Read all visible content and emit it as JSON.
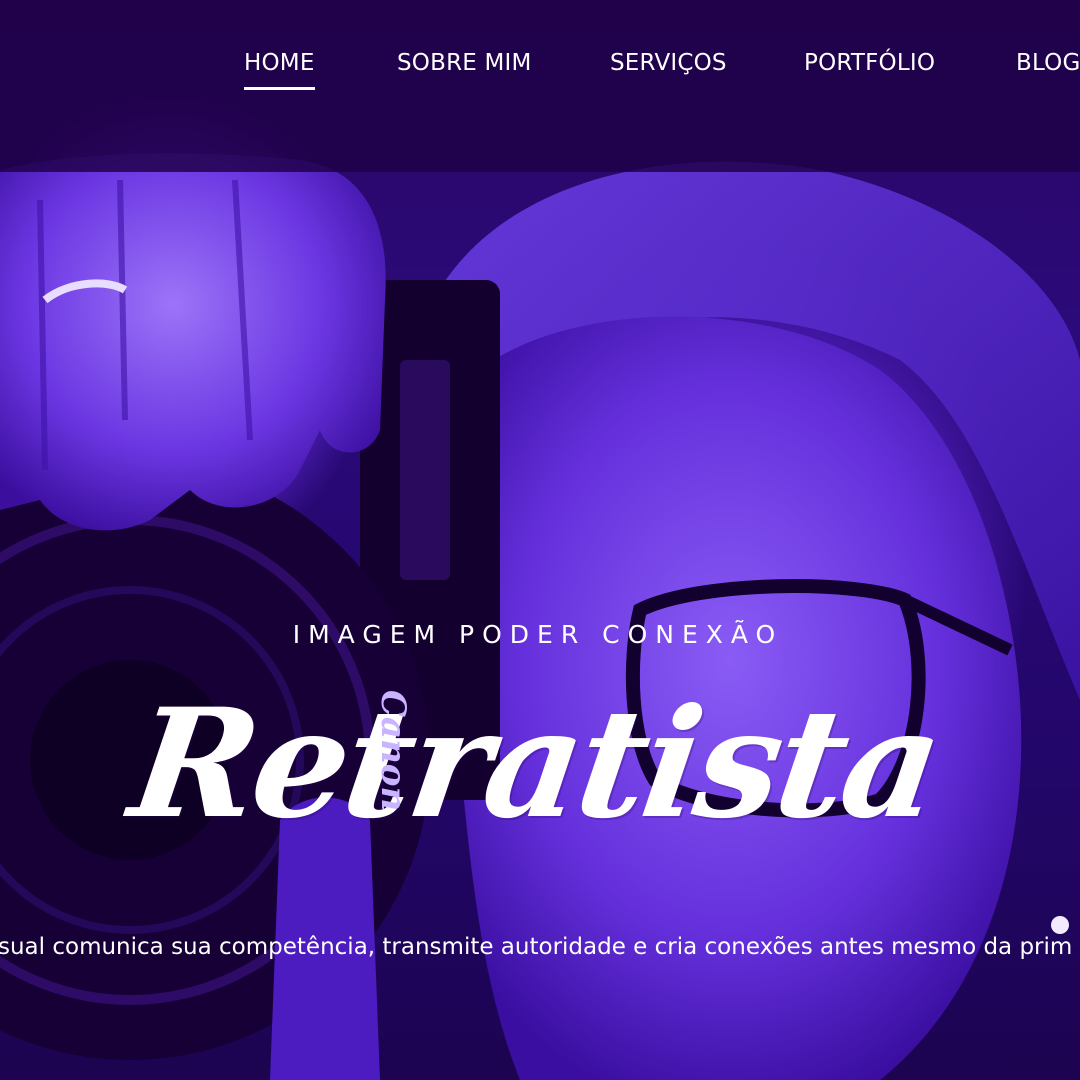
{
  "nav": {
    "items": [
      {
        "label": "HOME",
        "active": true
      },
      {
        "label": "SOBRE MIM",
        "active": false
      },
      {
        "label": "SERVIÇOS",
        "active": false
      },
      {
        "label": "PORTFÓLIO",
        "active": false
      },
      {
        "label": "BLOG",
        "active": false
      }
    ]
  },
  "hero": {
    "tagline": "IMAGEM PODER CONEXÃO",
    "title": "Retratista",
    "subline": "visual comunica sua competência, transmite autoridade e cria conexões antes mesmo da prim",
    "camera_brand": "Canon",
    "photo_description_icon": "photographer-photo"
  },
  "colors": {
    "overlay": "#1e0046",
    "accent": "#5a22d8",
    "text": "#ffffff"
  }
}
